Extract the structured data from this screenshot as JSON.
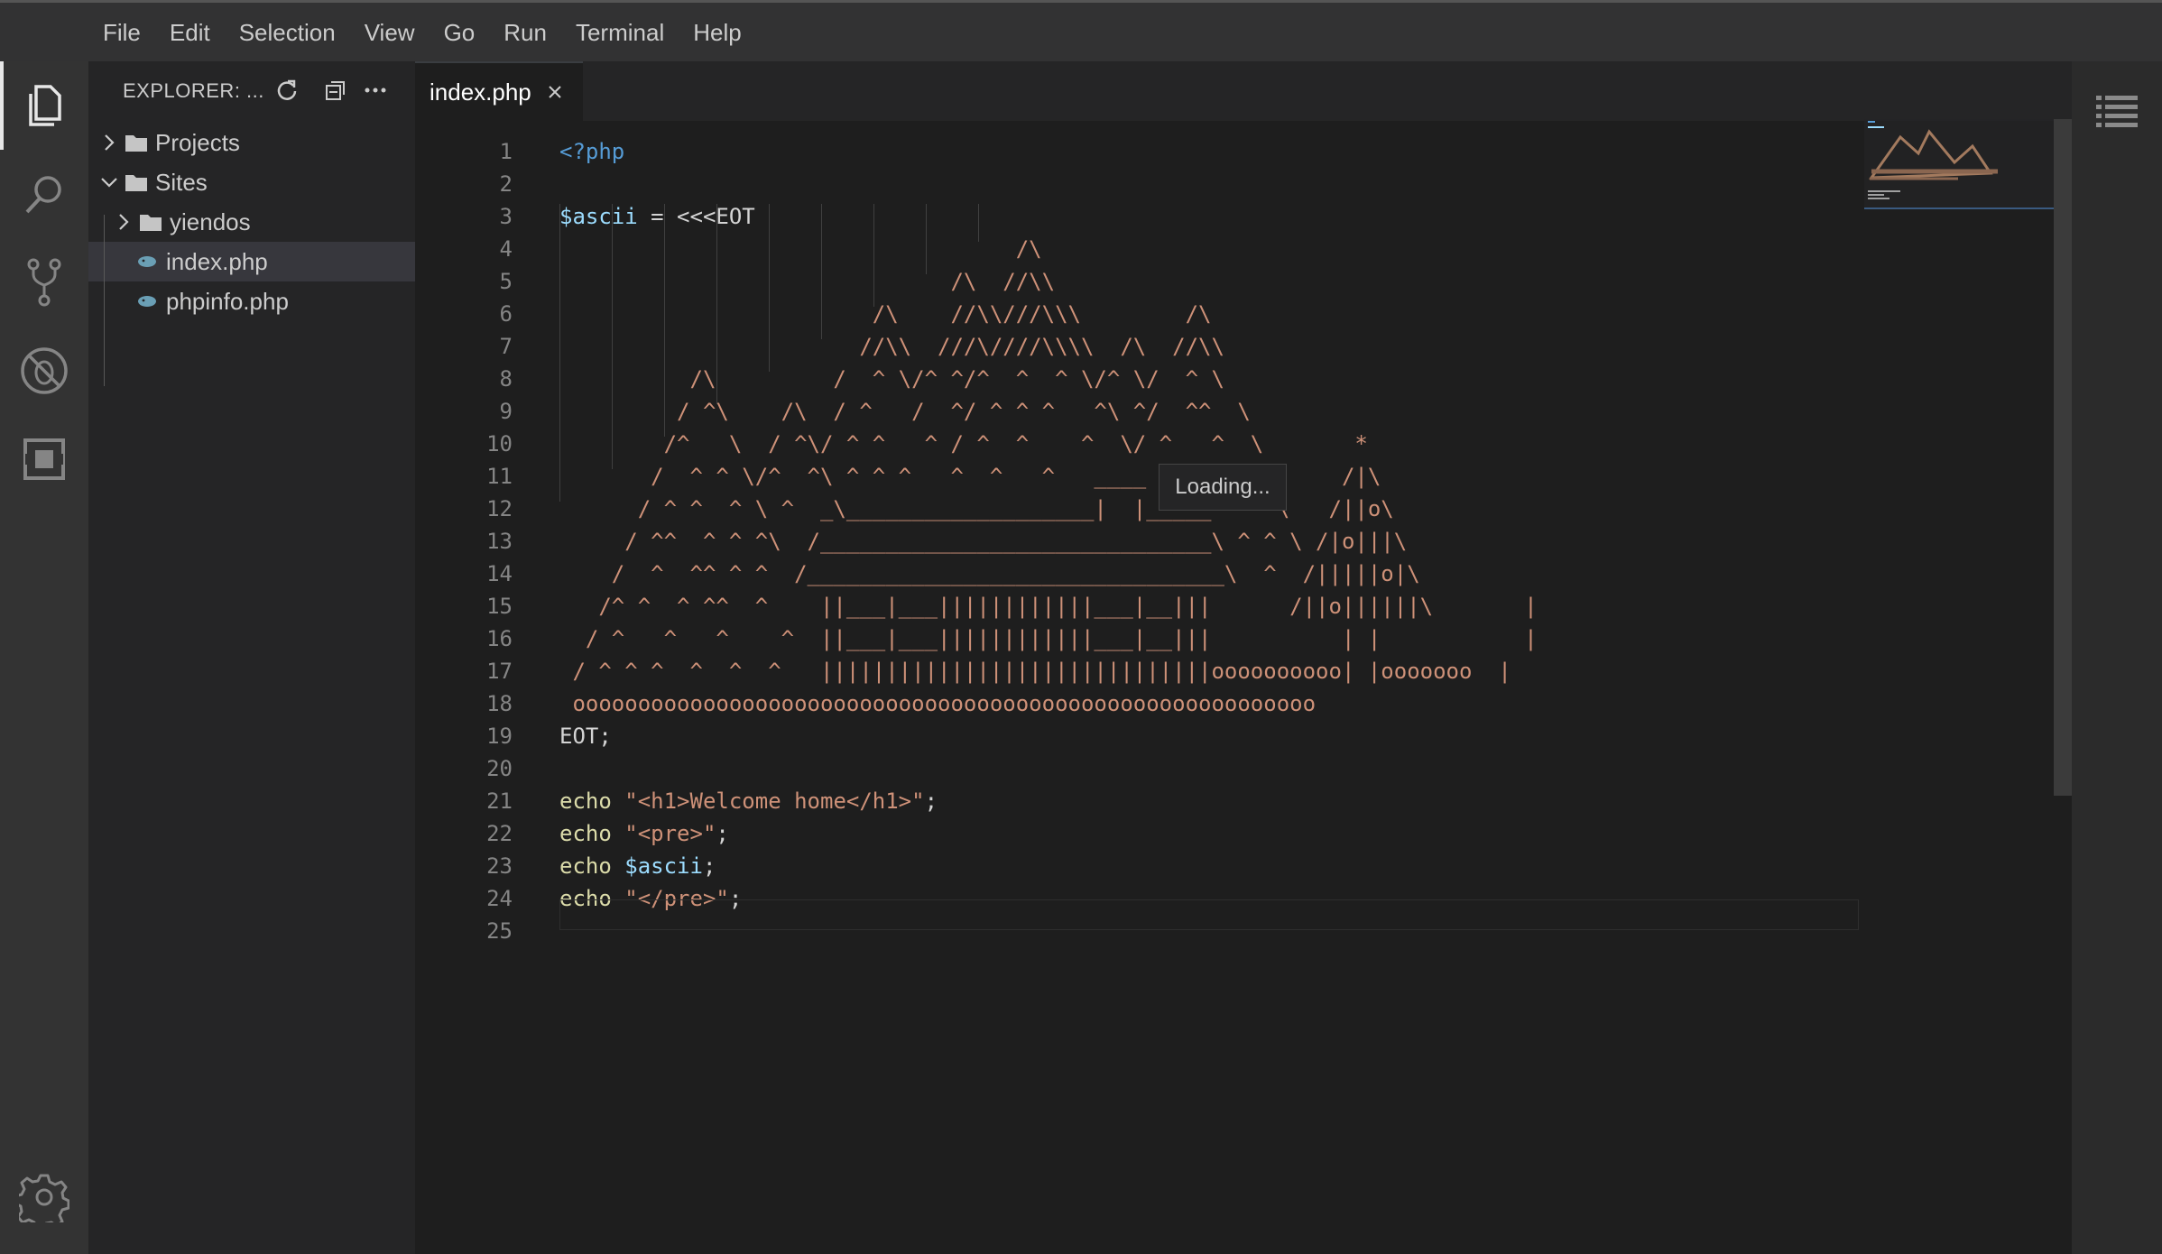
{
  "menu": [
    "File",
    "Edit",
    "Selection",
    "View",
    "Go",
    "Run",
    "Terminal",
    "Help"
  ],
  "activity_bar": {
    "items": [
      "explorer-icon",
      "search-icon",
      "source-control-icon",
      "debug-icon",
      "extensions-icon"
    ],
    "bottom": "gear-icon"
  },
  "sidebar": {
    "title": "EXPLORER: ...",
    "actions": [
      "refresh-icon",
      "collapse-all-icon",
      "more-icon"
    ],
    "tree": [
      {
        "label": "Projects",
        "type": "folder",
        "expanded": false,
        "depth": 0
      },
      {
        "label": "Sites",
        "type": "folder",
        "expanded": true,
        "depth": 0
      },
      {
        "label": "yiendos",
        "type": "folder",
        "expanded": false,
        "depth": 1
      },
      {
        "label": "index.php",
        "type": "php-file",
        "depth": 1,
        "selected": true
      },
      {
        "label": "phpinfo.php",
        "type": "php-file",
        "depth": 1
      }
    ]
  },
  "tabs": [
    {
      "label": "index.php",
      "active": true
    }
  ],
  "editor": {
    "lines": [
      [
        {
          "c": "kw",
          "t": "<?php"
        }
      ],
      [],
      [
        {
          "c": "var",
          "t": "$ascii"
        },
        {
          "c": "plain",
          "t": " = <<<EOT"
        }
      ],
      [
        {
          "c": "art",
          "t": "                                   /\\"
        }
      ],
      [
        {
          "c": "art",
          "t": "                              /\\  //\\\\"
        }
      ],
      [
        {
          "c": "art",
          "t": "                        /\\    //\\\\///\\\\\\        /\\"
        }
      ],
      [
        {
          "c": "art",
          "t": "                       //\\\\  ///\\////\\\\\\\\  /\\  //\\\\"
        }
      ],
      [
        {
          "c": "art",
          "t": "          /\\         /  ^ \\/^ ^/^  ^  ^ \\/^ \\/  ^ \\"
        }
      ],
      [
        {
          "c": "art",
          "t": "         / ^\\    /\\  / ^   /  ^/ ^ ^ ^   ^\\ ^/  ^^  \\"
        }
      ],
      [
        {
          "c": "art",
          "t": "        /^   \\  / ^\\/ ^ ^   ^ / ^  ^    ^  \\/ ^   ^  \\       *"
        }
      ],
      [
        {
          "c": "art",
          "t": "       /  ^ ^ \\/^  ^\\ ^ ^ ^   ^  ^   ^   ____  ^   ^  \\     /|\\"
        }
      ],
      [
        {
          "c": "art",
          "t": "      / ^ ^  ^ \\ ^  _\\___________________|  |_____^ ^  \\   /||o\\"
        }
      ],
      [
        {
          "c": "art",
          "t": "     / ^^  ^ ^ ^\\  /______________________________\\ ^ ^ \\ /|o|||\\"
        }
      ],
      [
        {
          "c": "art",
          "t": "    /  ^  ^^ ^ ^  /________________________________\\  ^  /|||||o|\\"
        }
      ],
      [
        {
          "c": "art",
          "t": "   /^ ^  ^ ^^  ^    ||___|___||||||||||||___|__|||      /||o||||||\\       |"
        }
      ],
      [
        {
          "c": "art",
          "t": "  / ^   ^   ^    ^  ||___|___||||||||||||___|__|||          | |           |"
        }
      ],
      [
        {
          "c": "art",
          "t": " / ^ ^ ^  ^  ^  ^   ||||||||||||||||||||||||||||||oooooooooo| |ooooooo  |"
        }
      ],
      [
        {
          "c": "art",
          "t": " ooooooooooooooooooooooooooooooooooooooooooooooooooooooooo"
        }
      ],
      [
        {
          "c": "plain",
          "t": "EOT;"
        }
      ],
      [],
      [
        {
          "c": "fn",
          "t": "echo"
        },
        {
          "c": "plain",
          "t": " "
        },
        {
          "c": "str",
          "t": "\"<h1>Welcome home</h1>\""
        },
        {
          "c": "plain",
          "t": ";"
        }
      ],
      [
        {
          "c": "fn",
          "t": "echo"
        },
        {
          "c": "plain",
          "t": " "
        },
        {
          "c": "str",
          "t": "\"<pre>\""
        },
        {
          "c": "plain",
          "t": ";"
        }
      ],
      [
        {
          "c": "fn",
          "t": "echo"
        },
        {
          "c": "plain",
          "t": " "
        },
        {
          "c": "var",
          "t": "$ascii"
        },
        {
          "c": "plain",
          "t": ";"
        }
      ],
      [
        {
          "c": "fn",
          "t": "echo"
        },
        {
          "c": "plain",
          "t": " "
        },
        {
          "c": "str",
          "t": "\"</pre>\""
        },
        {
          "c": "plain",
          "t": ";"
        }
      ],
      []
    ]
  },
  "loading_tooltip": "Loading...",
  "colors": {
    "keyword": "#569cd6",
    "variable": "#9cdcfe",
    "function": "#dcdcaa",
    "string": "#ce9178",
    "text": "#d4d4d4"
  }
}
